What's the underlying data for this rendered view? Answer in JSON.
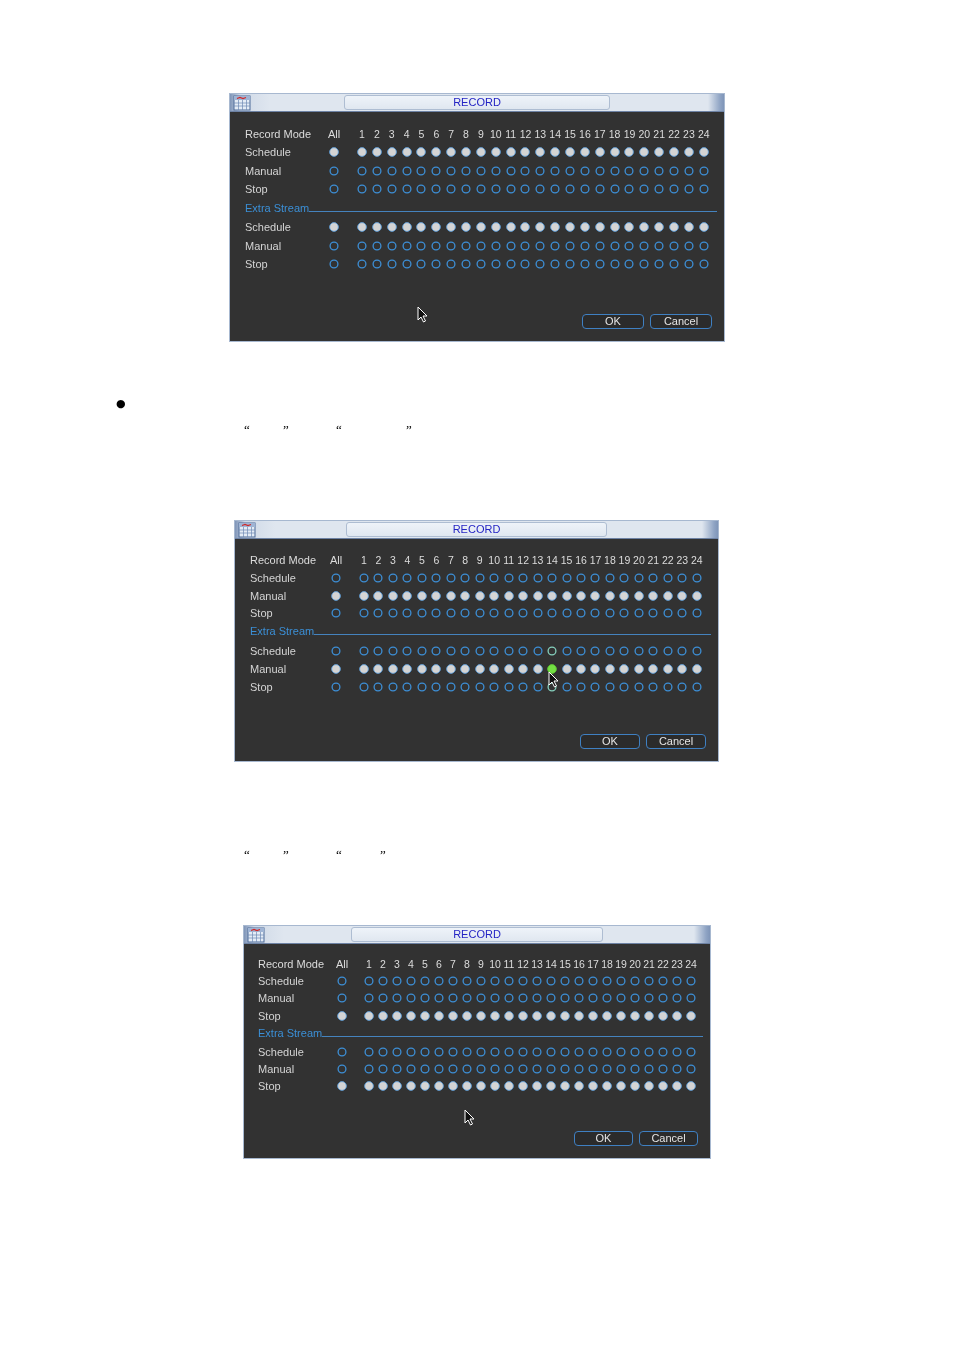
{
  "blocks": [
    {
      "kind": "dialog",
      "title": "RECORD",
      "header": {
        "label": "Record Mode",
        "all": "All",
        "channels": [
          "1",
          "2",
          "3",
          "4",
          "5",
          "6",
          "7",
          "8",
          "9",
          "10",
          "11",
          "12",
          "13",
          "14",
          "15",
          "16",
          "17",
          "18",
          "19",
          "20",
          "21",
          "22",
          "23",
          "24"
        ]
      },
      "sections": [
        {
          "rows": [
            {
              "label": "Schedule",
              "all": {
                "selected": true
              },
              "channels": [
                {
                  "selected": true
                },
                {
                  "selected": true
                },
                {
                  "selected": true
                },
                {
                  "selected": true
                },
                {
                  "selected": true
                },
                {
                  "selected": true
                },
                {
                  "selected": true
                },
                {
                  "selected": true
                },
                {
                  "selected": true
                },
                {
                  "selected": true
                },
                {
                  "selected": true
                },
                {
                  "selected": true
                },
                {
                  "selected": true
                },
                {
                  "selected": true
                },
                {
                  "selected": true
                },
                {
                  "selected": true
                },
                {
                  "selected": true
                },
                {
                  "selected": true
                },
                {
                  "selected": true
                },
                {
                  "selected": true
                },
                {
                  "selected": true
                },
                {
                  "selected": true
                },
                {
                  "selected": true
                },
                {
                  "selected": true
                }
              ]
            },
            {
              "label": "Manual",
              "all": {
                "selected": false
              },
              "channels": [
                {
                  "selected": false
                },
                {
                  "selected": false
                },
                {
                  "selected": false
                },
                {
                  "selected": false
                },
                {
                  "selected": false
                },
                {
                  "selected": false
                },
                {
                  "selected": false
                },
                {
                  "selected": false
                },
                {
                  "selected": false
                },
                {
                  "selected": false
                },
                {
                  "selected": false
                },
                {
                  "selected": false
                },
                {
                  "selected": false
                },
                {
                  "selected": false
                },
                {
                  "selected": false
                },
                {
                  "selected": false
                },
                {
                  "selected": false
                },
                {
                  "selected": false
                },
                {
                  "selected": false
                },
                {
                  "selected": false
                },
                {
                  "selected": false
                },
                {
                  "selected": false
                },
                {
                  "selected": false
                },
                {
                  "selected": false
                }
              ]
            },
            {
              "label": "Stop",
              "all": {
                "selected": false
              },
              "channels": [
                {
                  "selected": false
                },
                {
                  "selected": false
                },
                {
                  "selected": false
                },
                {
                  "selected": false
                },
                {
                  "selected": false
                },
                {
                  "selected": false
                },
                {
                  "selected": false
                },
                {
                  "selected": false
                },
                {
                  "selected": false
                },
                {
                  "selected": false
                },
                {
                  "selected": false
                },
                {
                  "selected": false
                },
                {
                  "selected": false
                },
                {
                  "selected": false
                },
                {
                  "selected": false
                },
                {
                  "selected": false
                },
                {
                  "selected": false
                },
                {
                  "selected": false
                },
                {
                  "selected": false
                },
                {
                  "selected": false
                },
                {
                  "selected": false
                },
                {
                  "selected": false
                },
                {
                  "selected": false
                },
                {
                  "selected": false
                }
              ]
            }
          ]
        },
        {
          "heading": "Extra Stream",
          "rows": [
            {
              "label": "Schedule",
              "all": {
                "selected": true
              },
              "channels": [
                {
                  "selected": true
                },
                {
                  "selected": true
                },
                {
                  "selected": true
                },
                {
                  "selected": true
                },
                {
                  "selected": true
                },
                {
                  "selected": true
                },
                {
                  "selected": true
                },
                {
                  "selected": true
                },
                {
                  "selected": true
                },
                {
                  "selected": true
                },
                {
                  "selected": true
                },
                {
                  "selected": true
                },
                {
                  "selected": true
                },
                {
                  "selected": true
                },
                {
                  "selected": true
                },
                {
                  "selected": true
                },
                {
                  "selected": true
                },
                {
                  "selected": true
                },
                {
                  "selected": true
                },
                {
                  "selected": true
                },
                {
                  "selected": true
                },
                {
                  "selected": true
                },
                {
                  "selected": true
                },
                {
                  "selected": true
                }
              ]
            },
            {
              "label": "Manual",
              "all": {
                "selected": false
              },
              "channels": [
                {
                  "selected": false
                },
                {
                  "selected": false
                },
                {
                  "selected": false
                },
                {
                  "selected": false
                },
                {
                  "selected": false
                },
                {
                  "selected": false
                },
                {
                  "selected": false
                },
                {
                  "selected": false
                },
                {
                  "selected": false
                },
                {
                  "selected": false
                },
                {
                  "selected": false
                },
                {
                  "selected": false
                },
                {
                  "selected": false
                },
                {
                  "selected": false
                },
                {
                  "selected": false
                },
                {
                  "selected": false
                },
                {
                  "selected": false
                },
                {
                  "selected": false
                },
                {
                  "selected": false
                },
                {
                  "selected": false
                },
                {
                  "selected": false
                },
                {
                  "selected": false
                },
                {
                  "selected": false
                },
                {
                  "selected": false
                }
              ]
            },
            {
              "label": "Stop",
              "all": {
                "selected": false
              },
              "channels": [
                {
                  "selected": false
                },
                {
                  "selected": false
                },
                {
                  "selected": false
                },
                {
                  "selected": false
                },
                {
                  "selected": false
                },
                {
                  "selected": false
                },
                {
                  "selected": false
                },
                {
                  "selected": false
                },
                {
                  "selected": false
                },
                {
                  "selected": false
                },
                {
                  "selected": false
                },
                {
                  "selected": false
                },
                {
                  "selected": false
                },
                {
                  "selected": false
                },
                {
                  "selected": false
                },
                {
                  "selected": false
                },
                {
                  "selected": false
                },
                {
                  "selected": false
                },
                {
                  "selected": false
                },
                {
                  "selected": false
                },
                {
                  "selected": false
                },
                {
                  "selected": false
                },
                {
                  "selected": false
                },
                {
                  "selected": false
                }
              ]
            }
          ]
        }
      ],
      "buttons": [
        "OK",
        "Cancel"
      ]
    },
    {
      "kind": "paragraph",
      "bullet": "●",
      "quotes": [
        "“",
        "”",
        "“",
        "”"
      ]
    },
    {
      "kind": "dialog",
      "title": "RECORD",
      "header": {
        "label": "Record Mode",
        "all": "All",
        "channels": [
          "1",
          "2",
          "3",
          "4",
          "5",
          "6",
          "7",
          "8",
          "9",
          "10",
          "11",
          "12",
          "13",
          "14",
          "15",
          "16",
          "17",
          "18",
          "19",
          "20",
          "21",
          "22",
          "23",
          "24"
        ]
      },
      "sections": [
        {
          "rows": [
            {
              "label": "Schedule",
              "all": {
                "selected": false
              },
              "channels": [
                {
                  "selected": false
                },
                {
                  "selected": false
                },
                {
                  "selected": false
                },
                {
                  "selected": false
                },
                {
                  "selected": false
                },
                {
                  "selected": false
                },
                {
                  "selected": false
                },
                {
                  "selected": false
                },
                {
                  "selected": false
                },
                {
                  "selected": false
                },
                {
                  "selected": false
                },
                {
                  "selected": false
                },
                {
                  "selected": false
                },
                {
                  "selected": false
                },
                {
                  "selected": false
                },
                {
                  "selected": false
                },
                {
                  "selected": false
                },
                {
                  "selected": false
                },
                {
                  "selected": false
                },
                {
                  "selected": false
                },
                {
                  "selected": false
                },
                {
                  "selected": false
                },
                {
                  "selected": false
                },
                {
                  "selected": false
                }
              ]
            },
            {
              "label": "Manual",
              "all": {
                "selected": true
              },
              "channels": [
                {
                  "selected": true
                },
                {
                  "selected": true
                },
                {
                  "selected": true
                },
                {
                  "selected": true
                },
                {
                  "selected": true
                },
                {
                  "selected": true
                },
                {
                  "selected": true
                },
                {
                  "selected": true
                },
                {
                  "selected": true
                },
                {
                  "selected": true
                },
                {
                  "selected": true
                },
                {
                  "selected": true
                },
                {
                  "selected": true
                },
                {
                  "selected": true
                },
                {
                  "selected": true
                },
                {
                  "selected": true
                },
                {
                  "selected": true
                },
                {
                  "selected": true
                },
                {
                  "selected": true
                },
                {
                  "selected": true
                },
                {
                  "selected": true
                },
                {
                  "selected": true
                },
                {
                  "selected": true
                },
                {
                  "selected": true
                }
              ]
            },
            {
              "label": "Stop",
              "all": {
                "selected": false
              },
              "channels": [
                {
                  "selected": false
                },
                {
                  "selected": false
                },
                {
                  "selected": false
                },
                {
                  "selected": false
                },
                {
                  "selected": false
                },
                {
                  "selected": false
                },
                {
                  "selected": false
                },
                {
                  "selected": false
                },
                {
                  "selected": false
                },
                {
                  "selected": false
                },
                {
                  "selected": false
                },
                {
                  "selected": false
                },
                {
                  "selected": false
                },
                {
                  "selected": false
                },
                {
                  "selected": false
                },
                {
                  "selected": false
                },
                {
                  "selected": false
                },
                {
                  "selected": false
                },
                {
                  "selected": false
                },
                {
                  "selected": false
                },
                {
                  "selected": false
                },
                {
                  "selected": false
                },
                {
                  "selected": false
                },
                {
                  "selected": false
                }
              ]
            }
          ]
        },
        {
          "heading": "Extra Stream",
          "rows": [
            {
              "label": "Schedule",
              "all": {
                "selected": false
              },
              "channels": [
                {
                  "selected": false,
                  "hovered": false
                },
                {
                  "selected": false,
                  "hovered": false
                },
                {
                  "selected": false,
                  "hovered": false
                },
                {
                  "selected": false,
                  "hovered": false
                },
                {
                  "selected": false,
                  "hovered": false
                },
                {
                  "selected": false,
                  "hovered": false
                },
                {
                  "selected": false,
                  "hovered": false
                },
                {
                  "selected": false,
                  "hovered": false
                },
                {
                  "selected": false,
                  "hovered": false
                },
                {
                  "selected": false,
                  "hovered": false
                },
                {
                  "selected": false,
                  "hovered": false
                },
                {
                  "selected": false,
                  "hovered": false
                },
                {
                  "selected": false,
                  "hovered": false
                },
                {
                  "selected": false,
                  "hovered": true
                },
                {
                  "selected": false,
                  "hovered": false
                },
                {
                  "selected": false,
                  "hovered": false
                },
                {
                  "selected": false,
                  "hovered": false
                },
                {
                  "selected": false,
                  "hovered": false
                },
                {
                  "selected": false,
                  "hovered": false
                },
                {
                  "selected": false,
                  "hovered": false
                },
                {
                  "selected": false,
                  "hovered": false
                },
                {
                  "selected": false,
                  "hovered": false
                },
                {
                  "selected": false,
                  "hovered": false
                },
                {
                  "selected": false,
                  "hovered": false
                }
              ]
            },
            {
              "label": "Manual",
              "all": {
                "selected": true
              },
              "channels": [
                {
                  "selected": true,
                  "hovered": false
                },
                {
                  "selected": true,
                  "hovered": false
                },
                {
                  "selected": true,
                  "hovered": false
                },
                {
                  "selected": true,
                  "hovered": false
                },
                {
                  "selected": true,
                  "hovered": false
                },
                {
                  "selected": true,
                  "hovered": false
                },
                {
                  "selected": true,
                  "hovered": false
                },
                {
                  "selected": true,
                  "hovered": false
                },
                {
                  "selected": true,
                  "hovered": false
                },
                {
                  "selected": true,
                  "hovered": false
                },
                {
                  "selected": true,
                  "hovered": false
                },
                {
                  "selected": true,
                  "hovered": false
                },
                {
                  "selected": true,
                  "hovered": false
                },
                {
                  "selected": true,
                  "hovered": true
                },
                {
                  "selected": true,
                  "hovered": false
                },
                {
                  "selected": true,
                  "hovered": false
                },
                {
                  "selected": true,
                  "hovered": false
                },
                {
                  "selected": true,
                  "hovered": false
                },
                {
                  "selected": true,
                  "hovered": false
                },
                {
                  "selected": true,
                  "hovered": false
                },
                {
                  "selected": true,
                  "hovered": false
                },
                {
                  "selected": true,
                  "hovered": false
                },
                {
                  "selected": true,
                  "hovered": false
                },
                {
                  "selected": true,
                  "hovered": false
                }
              ]
            },
            {
              "label": "Stop",
              "all": {
                "selected": false
              },
              "channels": [
                {
                  "selected": false,
                  "hovered": false
                },
                {
                  "selected": false,
                  "hovered": false
                },
                {
                  "selected": false,
                  "hovered": false
                },
                {
                  "selected": false,
                  "hovered": false
                },
                {
                  "selected": false,
                  "hovered": false
                },
                {
                  "selected": false,
                  "hovered": false
                },
                {
                  "selected": false,
                  "hovered": false
                },
                {
                  "selected": false,
                  "hovered": false
                },
                {
                  "selected": false,
                  "hovered": false
                },
                {
                  "selected": false,
                  "hovered": false
                },
                {
                  "selected": false,
                  "hovered": false
                },
                {
                  "selected": false,
                  "hovered": false
                },
                {
                  "selected": false,
                  "hovered": false
                },
                {
                  "selected": false,
                  "hovered": true
                },
                {
                  "selected": false,
                  "hovered": false
                },
                {
                  "selected": false,
                  "hovered": false
                },
                {
                  "selected": false,
                  "hovered": false
                },
                {
                  "selected": false,
                  "hovered": false
                },
                {
                  "selected": false,
                  "hovered": false
                },
                {
                  "selected": false,
                  "hovered": false
                },
                {
                  "selected": false,
                  "hovered": false
                },
                {
                  "selected": false,
                  "hovered": false
                },
                {
                  "selected": false,
                  "hovered": false
                },
                {
                  "selected": false,
                  "hovered": false
                }
              ]
            }
          ]
        }
      ],
      "buttons": [
        "OK",
        "Cancel"
      ]
    },
    {
      "kind": "paragraph",
      "quotes": [
        "“",
        "”",
        "“",
        "”"
      ]
    },
    {
      "kind": "dialog",
      "title": "RECORD",
      "header": {
        "label": "Record Mode",
        "all": "All",
        "channels": [
          "1",
          "2",
          "3",
          "4",
          "5",
          "6",
          "7",
          "8",
          "9",
          "10",
          "11",
          "12",
          "13",
          "14",
          "15",
          "16",
          "17",
          "18",
          "19",
          "20",
          "21",
          "22",
          "23",
          "24"
        ]
      },
      "sections": [
        {
          "rows": [
            {
              "label": "Schedule",
              "all": {
                "selected": false
              },
              "channels": [
                {
                  "selected": false
                },
                {
                  "selected": false
                },
                {
                  "selected": false
                },
                {
                  "selected": false
                },
                {
                  "selected": false
                },
                {
                  "selected": false
                },
                {
                  "selected": false
                },
                {
                  "selected": false
                },
                {
                  "selected": false
                },
                {
                  "selected": false
                },
                {
                  "selected": false
                },
                {
                  "selected": false
                },
                {
                  "selected": false
                },
                {
                  "selected": false
                },
                {
                  "selected": false
                },
                {
                  "selected": false
                },
                {
                  "selected": false
                },
                {
                  "selected": false
                },
                {
                  "selected": false
                },
                {
                  "selected": false
                },
                {
                  "selected": false
                },
                {
                  "selected": false
                },
                {
                  "selected": false
                },
                {
                  "selected": false
                }
              ]
            },
            {
              "label": "Manual",
              "all": {
                "selected": false
              },
              "channels": [
                {
                  "selected": false
                },
                {
                  "selected": false
                },
                {
                  "selected": false
                },
                {
                  "selected": false
                },
                {
                  "selected": false
                },
                {
                  "selected": false
                },
                {
                  "selected": false
                },
                {
                  "selected": false
                },
                {
                  "selected": false
                },
                {
                  "selected": false
                },
                {
                  "selected": false
                },
                {
                  "selected": false
                },
                {
                  "selected": false
                },
                {
                  "selected": false
                },
                {
                  "selected": false
                },
                {
                  "selected": false
                },
                {
                  "selected": false
                },
                {
                  "selected": false
                },
                {
                  "selected": false
                },
                {
                  "selected": false
                },
                {
                  "selected": false
                },
                {
                  "selected": false
                },
                {
                  "selected": false
                },
                {
                  "selected": false
                }
              ]
            },
            {
              "label": "Stop",
              "all": {
                "selected": true
              },
              "channels": [
                {
                  "selected": true
                },
                {
                  "selected": true
                },
                {
                  "selected": true
                },
                {
                  "selected": true
                },
                {
                  "selected": true
                },
                {
                  "selected": true
                },
                {
                  "selected": true
                },
                {
                  "selected": true
                },
                {
                  "selected": true
                },
                {
                  "selected": true
                },
                {
                  "selected": true
                },
                {
                  "selected": true
                },
                {
                  "selected": true
                },
                {
                  "selected": true
                },
                {
                  "selected": true
                },
                {
                  "selected": true
                },
                {
                  "selected": true
                },
                {
                  "selected": true
                },
                {
                  "selected": true
                },
                {
                  "selected": true
                },
                {
                  "selected": true
                },
                {
                  "selected": true
                },
                {
                  "selected": true
                },
                {
                  "selected": true
                }
              ]
            }
          ]
        },
        {
          "heading": "Extra Stream",
          "rows": [
            {
              "label": "Schedule",
              "all": {
                "selected": false
              },
              "channels": [
                {
                  "selected": false
                },
                {
                  "selected": false
                },
                {
                  "selected": false
                },
                {
                  "selected": false
                },
                {
                  "selected": false
                },
                {
                  "selected": false
                },
                {
                  "selected": false
                },
                {
                  "selected": false
                },
                {
                  "selected": false
                },
                {
                  "selected": false
                },
                {
                  "selected": false
                },
                {
                  "selected": false
                },
                {
                  "selected": false
                },
                {
                  "selected": false
                },
                {
                  "selected": false
                },
                {
                  "selected": false
                },
                {
                  "selected": false
                },
                {
                  "selected": false
                },
                {
                  "selected": false
                },
                {
                  "selected": false
                },
                {
                  "selected": false
                },
                {
                  "selected": false
                },
                {
                  "selected": false
                },
                {
                  "selected": false
                }
              ]
            },
            {
              "label": "Manual",
              "all": {
                "selected": false
              },
              "channels": [
                {
                  "selected": false
                },
                {
                  "selected": false
                },
                {
                  "selected": false
                },
                {
                  "selected": false
                },
                {
                  "selected": false
                },
                {
                  "selected": false
                },
                {
                  "selected": false
                },
                {
                  "selected": false
                },
                {
                  "selected": false
                },
                {
                  "selected": false
                },
                {
                  "selected": false
                },
                {
                  "selected": false
                },
                {
                  "selected": false
                },
                {
                  "selected": false
                },
                {
                  "selected": false
                },
                {
                  "selected": false
                },
                {
                  "selected": false
                },
                {
                  "selected": false
                },
                {
                  "selected": false
                },
                {
                  "selected": false
                },
                {
                  "selected": false
                },
                {
                  "selected": false
                },
                {
                  "selected": false
                },
                {
                  "selected": false
                }
              ]
            },
            {
              "label": "Stop",
              "all": {
                "selected": true
              },
              "channels": [
                {
                  "selected": true
                },
                {
                  "selected": true
                },
                {
                  "selected": true
                },
                {
                  "selected": true
                },
                {
                  "selected": true
                },
                {
                  "selected": true
                },
                {
                  "selected": true
                },
                {
                  "selected": true
                },
                {
                  "selected": true
                },
                {
                  "selected": true
                },
                {
                  "selected": true
                },
                {
                  "selected": true
                },
                {
                  "selected": true
                },
                {
                  "selected": true
                },
                {
                  "selected": true
                },
                {
                  "selected": true
                },
                {
                  "selected": true
                },
                {
                  "selected": true
                },
                {
                  "selected": true
                },
                {
                  "selected": true
                },
                {
                  "selected": true
                },
                {
                  "selected": true
                },
                {
                  "selected": true
                },
                {
                  "selected": true
                }
              ]
            }
          ]
        }
      ],
      "buttons": [
        "OK",
        "Cancel"
      ]
    }
  ]
}
